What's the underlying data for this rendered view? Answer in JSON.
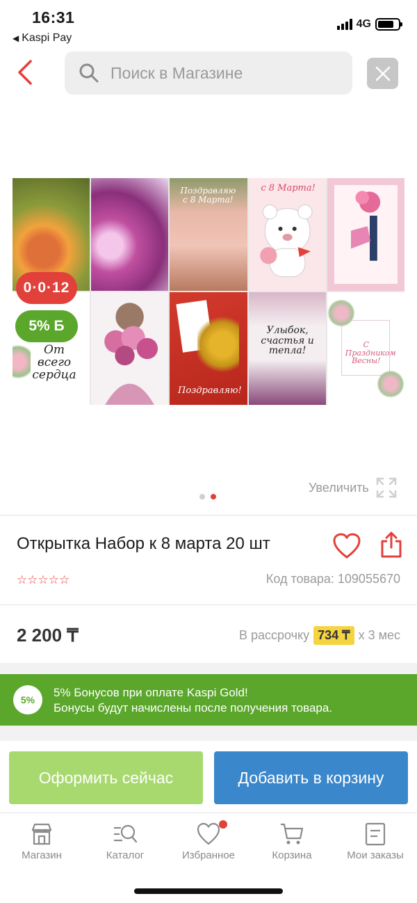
{
  "status_bar": {
    "time": "16:31",
    "back_app": "Kaspi Pay",
    "network": "4G"
  },
  "header": {
    "search_placeholder": "Поиск в Магазине"
  },
  "gallery": {
    "badge_installment": "0·0·12",
    "badge_bonus": "5% Б",
    "card_texts": {
      "c3": "Поздравляю с 8 Марта!",
      "c4": "с 8 Марта!",
      "c6": "От всего сердца",
      "c9": "Поздравляю!",
      "c10": "Улыбок, счастья и тепла!",
      "c11": "С Праздником Весны!"
    },
    "zoom_label": "Увеличить",
    "page_count": 2,
    "active_page": 2
  },
  "product": {
    "title": "Открытка Набор к 8 марта 20 шт",
    "rating_stars": "☆☆☆☆☆",
    "sku": "Код товара: 109055670",
    "price": "2 200 ₸",
    "installment_prefix": "В рассрочку",
    "installment_amount": "734 ₸",
    "installment_suffix": "х 3 мес"
  },
  "bonus": {
    "badge": "5%",
    "line1": "5% Бонусов при оплате Kaspi Gold!",
    "line2": "Бонусы будут начислены после получения товара."
  },
  "actions": {
    "checkout": "Оформить сейчас",
    "add_to_cart": "Добавить в корзину"
  },
  "tabs": [
    {
      "label": "Магазин",
      "icon": "shop-icon"
    },
    {
      "label": "Каталог",
      "icon": "catalog-search-icon"
    },
    {
      "label": "Избранное",
      "icon": "heart-icon"
    },
    {
      "label": "Корзина",
      "icon": "cart-icon"
    },
    {
      "label": "Мои заказы",
      "icon": "orders-icon"
    }
  ],
  "colors": {
    "accent_red": "#e2403a",
    "bonus_green": "#5aa72b",
    "checkout_green": "#a8d96e",
    "cart_blue": "#3a87cc",
    "installment_yellow": "#f5d442"
  }
}
